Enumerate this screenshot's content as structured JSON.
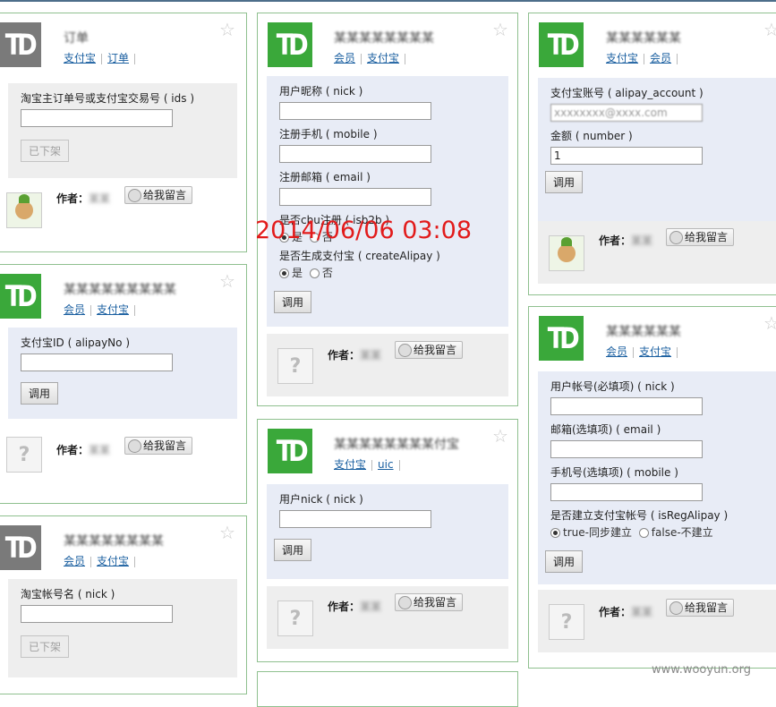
{
  "timestamp": "2014/06/06 03:08",
  "watermark": "www.wooyun.org",
  "logo_text": "TD",
  "common": {
    "author_label": "作者：",
    "message_button": "给我留言",
    "call_button": "调用",
    "unlisted_button": "已下架",
    "star_icon": "star-outline-icon",
    "colors": {
      "card_border": "#8fc08f",
      "logo_green": "#3aa83a",
      "logo_gray": "#7a7a7a",
      "link": "#1a5fa0",
      "timestamp": "#e21b1b"
    }
  },
  "cards": {
    "c1": {
      "title": "订单",
      "links": [
        "支付宝",
        "订单"
      ],
      "fields": [
        {
          "label": "淘宝主订单号或支付宝交易号 ( ids )",
          "value": ""
        }
      ],
      "author": "某某"
    },
    "c2": {
      "title": "某某某某某某某某某",
      "links": [
        "会员",
        "支付宝"
      ],
      "fields": [
        {
          "label": "支付宝ID ( alipayNo )",
          "value": ""
        }
      ],
      "author": "某某"
    },
    "c3": {
      "title": "某某某某某某某某",
      "links": [
        "会员",
        "支付宝"
      ],
      "fields": [
        {
          "label": "淘宝帐号名 ( nick )",
          "value": ""
        }
      ]
    },
    "c4": {
      "title": "某某某某某某某某",
      "links": [
        "会员",
        "支付宝"
      ],
      "fields": [
        {
          "label": "用户昵称 ( nick )",
          "value": ""
        },
        {
          "label": "注册手机 ( mobile )",
          "value": ""
        },
        {
          "label": "注册邮箱 ( email )",
          "value": ""
        }
      ],
      "isb2b_label": "是否cbu注册 ( isb2b )",
      "isb2b_options": [
        "是",
        "否"
      ],
      "alipay_label": "是否生成支付宝 ( createAlipay )",
      "alipay_options": [
        "是",
        "否"
      ],
      "author": "某某"
    },
    "c5": {
      "title": "某某某某某某某某付宝",
      "links": [
        "支付宝",
        "uic"
      ],
      "fields": [
        {
          "label": "用户nick ( nick )",
          "value": ""
        }
      ],
      "author": "某某"
    },
    "c6": {
      "title": "某某某某某某",
      "links": [
        "支付宝",
        "会员"
      ],
      "fields": [
        {
          "label": "支付宝账号 ( alipay_account )",
          "value": "xxxxxxxx@xxxx.com"
        },
        {
          "label": "金额 ( number )",
          "value": "1"
        }
      ],
      "author": "某某"
    },
    "c7": {
      "title": "某某某某某某",
      "links": [
        "会员",
        "支付宝"
      ],
      "fields": [
        {
          "label": "用户帐号(必填项) ( nick )",
          "value": ""
        },
        {
          "label": "邮箱(选填项) ( email )",
          "value": ""
        },
        {
          "label": "手机号(选填项) ( mobile )",
          "value": ""
        }
      ],
      "reg_label": "是否建立支付宝帐号 ( isRegAlipay )",
      "reg_options": [
        "true-同步建立",
        "false-不建立"
      ],
      "author": "某某"
    }
  }
}
